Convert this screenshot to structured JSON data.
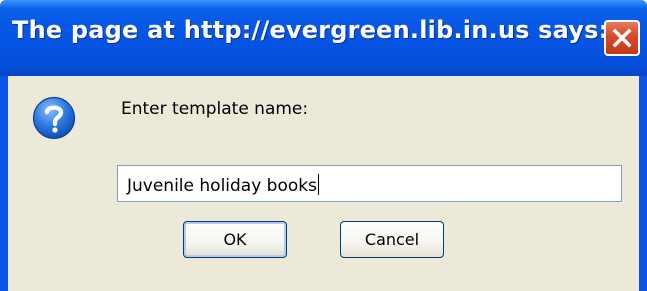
{
  "dialog": {
    "title": "The page at http://evergreen.lib.in.us says:",
    "close_icon": "close-icon",
    "help_icon": "question-icon",
    "prompt": "Enter template name:",
    "input_value": "Juvenile holiday books",
    "ok_label": "OK",
    "cancel_label": "Cancel"
  },
  "colors": {
    "titlebar": "#0554E3",
    "client_bg": "#ECE9D8",
    "close_button": "#D94A27",
    "input_border": "#7F9DB9",
    "button_border": "#003C74"
  }
}
